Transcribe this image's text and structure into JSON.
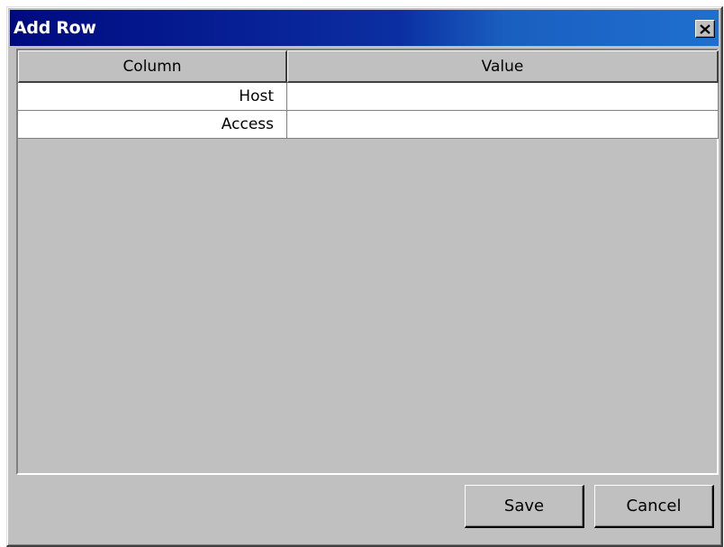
{
  "window": {
    "title": "Add Row",
    "close_icon": "close-icon",
    "title_bar_gradient": [
      "#000a80",
      "#1f6fcf"
    ]
  },
  "grid": {
    "columns": [
      "Column",
      "Value"
    ],
    "rows": [
      {
        "column": "Host",
        "value": ""
      },
      {
        "column": "Access",
        "value": ""
      }
    ]
  },
  "buttons": {
    "save_label": "Save",
    "cancel_label": "Cancel"
  }
}
